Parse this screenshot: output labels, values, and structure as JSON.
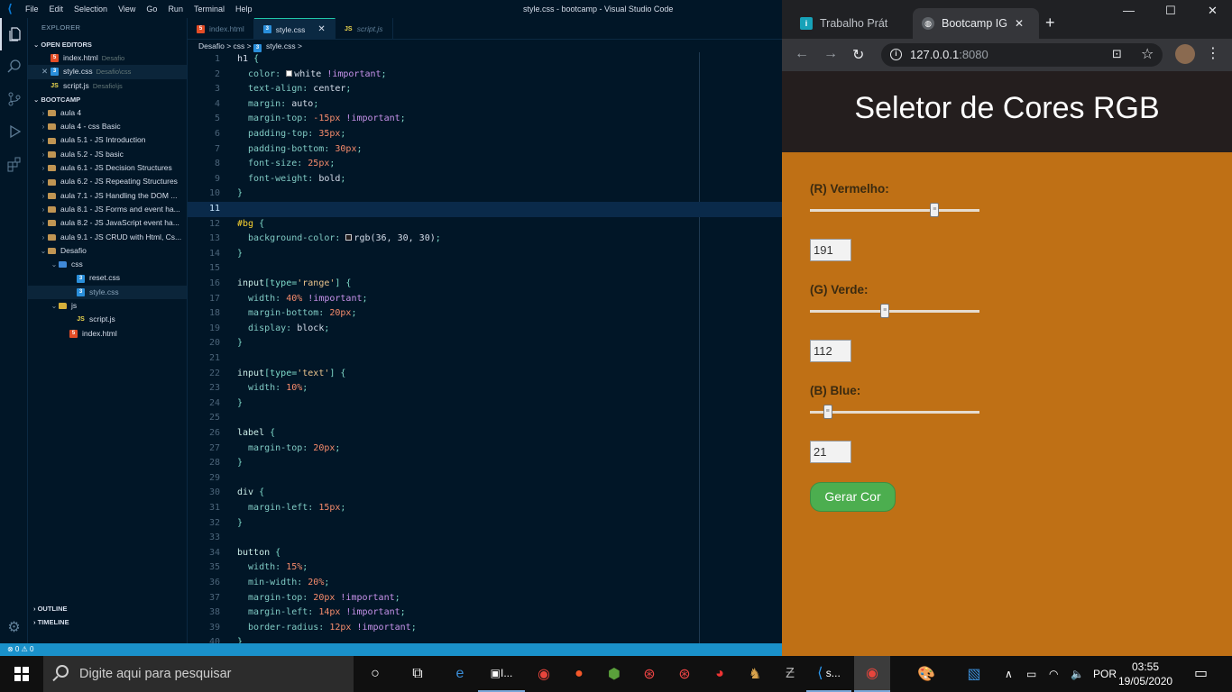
{
  "vscode": {
    "menu": [
      "File",
      "Edit",
      "Selection",
      "View",
      "Go",
      "Run",
      "Terminal",
      "Help"
    ],
    "window_title": "style.css - bootcamp - Visual Studio Code",
    "explorer_title": "EXPLORER",
    "open_editors_title": "OPEN EDITORS",
    "open_editors": [
      {
        "name": "index.html",
        "dir": "Desafio",
        "icon": "html"
      },
      {
        "name": "style.css",
        "dir": "Desafio\\css",
        "icon": "css"
      },
      {
        "name": "script.js",
        "dir": "Desafio\\js",
        "icon": "js"
      }
    ],
    "workspace_title": "BOOTCAMP",
    "tree": [
      {
        "name": "aula 4",
        "icon": "fold"
      },
      {
        "name": "aula 4 - css Basic",
        "icon": "fold"
      },
      {
        "name": "aula 5.1 - JS Introduction",
        "icon": "fold"
      },
      {
        "name": "aula 5.2 - JS basic",
        "icon": "fold"
      },
      {
        "name": "aula 6.1 - JS Decision Structures",
        "icon": "fold"
      },
      {
        "name": "aula 6.2 - JS Repeating Structures",
        "icon": "fold"
      },
      {
        "name": "aula 7.1 - JS Handling the DOM ...",
        "icon": "fold"
      },
      {
        "name": "aula 8.1 - JS Forms and event ha...",
        "icon": "fold"
      },
      {
        "name": "aula 8.2 - JS JavaScript event ha...",
        "icon": "fold"
      },
      {
        "name": "aula 9.1 - JS CRUD with Html, Cs...",
        "icon": "fold"
      },
      {
        "name": "Desafio",
        "icon": "fold"
      },
      {
        "name": "css",
        "icon": "fold css"
      },
      {
        "name": "reset.css",
        "icon": "css"
      },
      {
        "name": "style.css",
        "icon": "css"
      },
      {
        "name": "js",
        "icon": "fold js"
      },
      {
        "name": "script.js",
        "icon": "js"
      },
      {
        "name": "index.html",
        "icon": "html"
      }
    ],
    "outline_label": "OUTLINE",
    "timeline_label": "TIMELINE",
    "tabs": [
      "index.html",
      "style.css",
      "script.js"
    ],
    "breadcrumb": [
      "Desafio",
      ">",
      "css",
      ">",
      "style.css",
      ">"
    ],
    "status": "⊗ 0 ⚠ 0",
    "code_lines": [
      [
        [
          "h1",
          "sel-c"
        ],
        [
          " {",
          "punc"
        ]
      ],
      [
        [
          "  color: ",
          "prop"
        ],
        [
          "■",
          "wsq"
        ],
        [
          "white",
          "val"
        ],
        [
          " !important",
          "imp"
        ],
        [
          ";",
          "punc"
        ]
      ],
      [
        [
          "  text-align: ",
          "prop"
        ],
        [
          "center",
          "val"
        ],
        [
          ";",
          "punc"
        ]
      ],
      [
        [
          "  margin: ",
          "prop"
        ],
        [
          "auto",
          "val"
        ],
        [
          ";",
          "punc"
        ]
      ],
      [
        [
          "  margin-top: ",
          "prop"
        ],
        [
          "-15",
          "num"
        ],
        [
          "px",
          "unit"
        ],
        [
          " !important",
          "imp"
        ],
        [
          ";",
          "punc"
        ]
      ],
      [
        [
          "  padding-top: ",
          "prop"
        ],
        [
          "35",
          "num"
        ],
        [
          "px",
          "unit"
        ],
        [
          ";",
          "punc"
        ]
      ],
      [
        [
          "  padding-bottom: ",
          "prop"
        ],
        [
          "30",
          "num"
        ],
        [
          "px",
          "unit"
        ],
        [
          ";",
          "punc"
        ]
      ],
      [
        [
          "  font-size: ",
          "prop"
        ],
        [
          "25",
          "num"
        ],
        [
          "px",
          "unit"
        ],
        [
          ";",
          "punc"
        ]
      ],
      [
        [
          "  font-weight: ",
          "prop"
        ],
        [
          "bold",
          "val"
        ],
        [
          ";",
          "punc"
        ]
      ],
      [
        [
          "}",
          "punc"
        ]
      ],
      [],
      [
        [
          "#bg",
          "id"
        ],
        [
          " {",
          "punc"
        ]
      ],
      [
        [
          "  background-color: ",
          "prop"
        ],
        [
          "■",
          "dsq"
        ],
        [
          "rgb(36, 30, 30)",
          "val"
        ],
        [
          ";",
          "punc"
        ]
      ],
      [
        [
          "}",
          "punc"
        ]
      ],
      [],
      [
        [
          "input",
          "tag"
        ],
        [
          "[type=",
          "punc"
        ],
        [
          "'range'",
          "str"
        ],
        [
          "] {",
          "punc"
        ]
      ],
      [
        [
          "  width: ",
          "prop"
        ],
        [
          "40",
          "num"
        ],
        [
          "%",
          "unit"
        ],
        [
          " !important",
          "imp"
        ],
        [
          ";",
          "punc"
        ]
      ],
      [
        [
          "  margin-bottom: ",
          "prop"
        ],
        [
          "20",
          "num"
        ],
        [
          "px",
          "unit"
        ],
        [
          ";",
          "punc"
        ]
      ],
      [
        [
          "  display: ",
          "prop"
        ],
        [
          "block",
          "val"
        ],
        [
          ";",
          "punc"
        ]
      ],
      [
        [
          "}",
          "punc"
        ]
      ],
      [],
      [
        [
          "input",
          "tag"
        ],
        [
          "[type=",
          "punc"
        ],
        [
          "'text'",
          "str"
        ],
        [
          "] {",
          "punc"
        ]
      ],
      [
        [
          "  width: ",
          "prop"
        ],
        [
          "10",
          "num"
        ],
        [
          "%",
          "unit"
        ],
        [
          ";",
          "punc"
        ]
      ],
      [
        [
          "}",
          "punc"
        ]
      ],
      [],
      [
        [
          "label",
          "tag"
        ],
        [
          " {",
          "punc"
        ]
      ],
      [
        [
          "  margin-top: ",
          "prop"
        ],
        [
          "20",
          "num"
        ],
        [
          "px",
          "unit"
        ],
        [
          ";",
          "punc"
        ]
      ],
      [
        [
          "}",
          "punc"
        ]
      ],
      [],
      [
        [
          "div",
          "tag"
        ],
        [
          " {",
          "punc"
        ]
      ],
      [
        [
          "  margin-left: ",
          "prop"
        ],
        [
          "15",
          "num"
        ],
        [
          "px",
          "unit"
        ],
        [
          ";",
          "punc"
        ]
      ],
      [
        [
          "}",
          "punc"
        ]
      ],
      [],
      [
        [
          "button",
          "tag"
        ],
        [
          " {",
          "punc"
        ]
      ],
      [
        [
          "  width: ",
          "prop"
        ],
        [
          "15",
          "num"
        ],
        [
          "%",
          "unit"
        ],
        [
          ";",
          "punc"
        ]
      ],
      [
        [
          "  min-width: ",
          "prop"
        ],
        [
          "20",
          "num"
        ],
        [
          "%",
          "unit"
        ],
        [
          ";",
          "punc"
        ]
      ],
      [
        [
          "  margin-top: ",
          "prop"
        ],
        [
          "20",
          "num"
        ],
        [
          "px",
          "unit"
        ],
        [
          " !important",
          "imp"
        ],
        [
          ";",
          "punc"
        ]
      ],
      [
        [
          "  margin-left: ",
          "prop"
        ],
        [
          "14",
          "num"
        ],
        [
          "px",
          "unit"
        ],
        [
          " !important",
          "imp"
        ],
        [
          ";",
          "punc"
        ]
      ],
      [
        [
          "  border-radius: ",
          "prop"
        ],
        [
          "12",
          "num"
        ],
        [
          "px",
          "unit"
        ],
        [
          " !important",
          "imp"
        ],
        [
          ";",
          "punc"
        ]
      ],
      [
        [
          "}",
          "punc"
        ]
      ]
    ],
    "current_line": 11
  },
  "chrome": {
    "tabs": [
      {
        "title": "Trabalho Prát",
        "active": false
      },
      {
        "title": "Bootcamp IG",
        "active": true
      }
    ],
    "new_tab": "+",
    "url_host": "127.0.0.1",
    "url_port": ":8080"
  },
  "app": {
    "title": "Seletor de Cores RGB",
    "red_label": "(R) Vermelho:",
    "red_value": "191",
    "red_level": 191,
    "green_label": "(G) Verde:",
    "green_value": "112",
    "green_level": 112,
    "blue_label": "(B) Blue:",
    "blue_value": "21",
    "blue_level": 21,
    "button_label": "Gerar Cor",
    "bg_color": "#bf7015"
  },
  "taskbar": {
    "search_placeholder": "Digite aqui para pesquisar",
    "lang": "POR",
    "time": "03:55",
    "date": "19/05/2020",
    "pinned_label_1": "I...",
    "pinned_label_2": "s..."
  }
}
